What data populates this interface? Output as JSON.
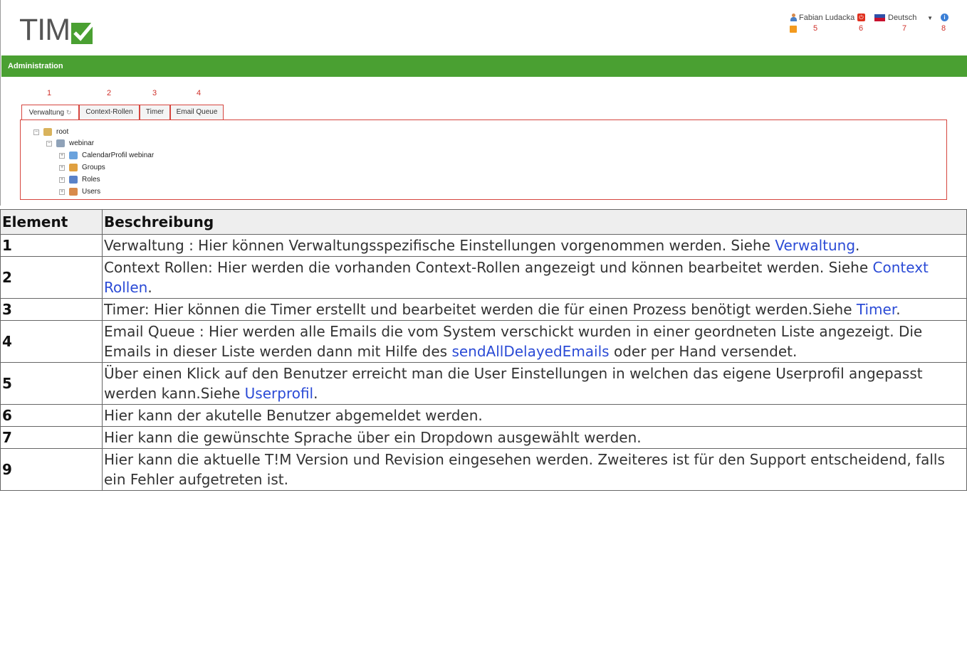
{
  "app": {
    "logo_text": "TIM"
  },
  "topbar": {
    "user_name": "Fabian Ludacka",
    "language": "Deutsch",
    "markers": [
      "5",
      "6",
      "7",
      "8"
    ]
  },
  "header": {
    "title": "Administration"
  },
  "tabs": {
    "numbers": [
      "1",
      "2",
      "3",
      "4"
    ],
    "items": [
      {
        "label": "Verwaltung"
      },
      {
        "label": "Context-Rollen"
      },
      {
        "label": "Timer"
      },
      {
        "label": "Email Queue"
      }
    ]
  },
  "tree": {
    "root": "root",
    "child": "webinar",
    "items": [
      "CalendarProfil webinar",
      "Groups",
      "Roles",
      "Users"
    ]
  },
  "table": {
    "headers": [
      "Element",
      "Beschreibung"
    ],
    "rows": [
      {
        "key": "1",
        "text": "Verwaltung : Hier können Verwaltungsspezifische Einstellungen vorgenommen werden. Siehe ",
        "link": "Verwaltung",
        "after": "."
      },
      {
        "key": "2",
        "text": "Context Rollen: Hier werden die vorhanden Context-Rollen angezeigt und können bearbeitet werden. Siehe ",
        "link": "Context Rollen",
        "after": "."
      },
      {
        "key": "3",
        "text": "Timer: Hier können die Timer erstellt und bearbeitet werden die für einen Prozess benötigt werden.Siehe ",
        "link": "Timer",
        "after": "."
      },
      {
        "key": "4",
        "text": "Email Queue : Hier werden alle Emails die vom System verschickt wurden in einer geordneten Liste angezeigt. Die Emails in dieser Liste werden dann mit Hilfe des ",
        "link": "sendAllDelayedEmails",
        "after": " oder per Hand versendet."
      },
      {
        "key": "5",
        "text": "Über einen Klick auf den Benutzer erreicht man die User Einstellungen in welchen das eigene Userprofil angepasst werden kann.Siehe ",
        "link": "Userprofil",
        "after": "."
      },
      {
        "key": "6",
        "text": "Hier kann der akutelle Benutzer abgemeldet werden.",
        "link": "",
        "after": ""
      },
      {
        "key": "7",
        "text": "Hier kann die gewünschte Sprache über ein Dropdown ausgewählt werden.",
        "link": "",
        "after": ""
      },
      {
        "key": "9",
        "text": "Hier kann die aktuelle T!M Version und Revision eingesehen werden. Zweiteres ist für den Support entscheidend, falls ein Fehler aufgetreten ist.",
        "link": "",
        "after": ""
      }
    ]
  }
}
